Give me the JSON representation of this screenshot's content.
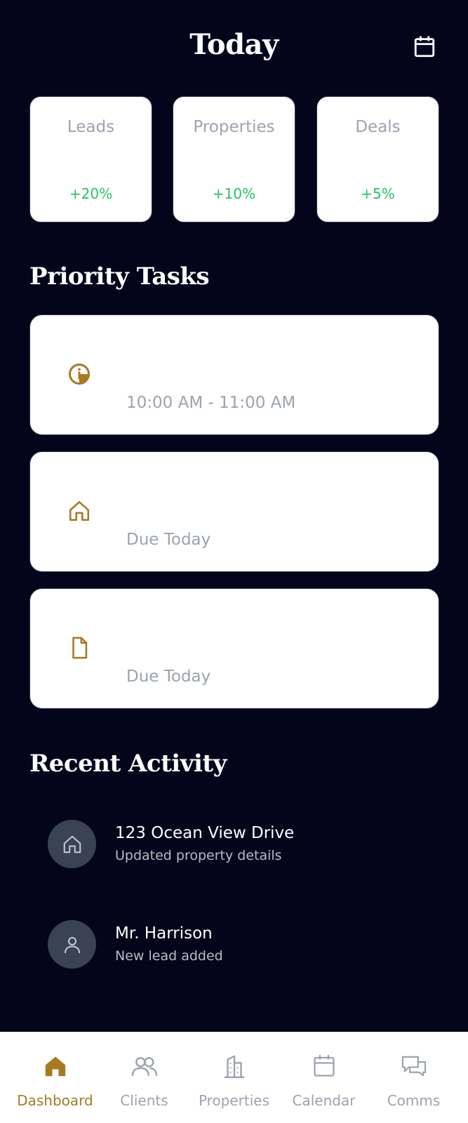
{
  "header": {
    "title": "Today",
    "calendar_icon": "calendar-icon"
  },
  "stats": [
    {
      "label": "Leads",
      "change": "+20%"
    },
    {
      "label": "Properties",
      "change": "+10%"
    },
    {
      "label": "Deals",
      "change": "+5%"
    }
  ],
  "priority_tasks": {
    "title": "Priority Tasks",
    "items": [
      {
        "icon": "info-clock-icon",
        "subtitle": "10:00 AM - 11:00 AM"
      },
      {
        "icon": "home-icon",
        "subtitle": "Due Today"
      },
      {
        "icon": "document-icon",
        "subtitle": "Due Today"
      }
    ]
  },
  "recent_activity": {
    "title": "Recent Activity",
    "items": [
      {
        "icon": "home-icon",
        "title": "123 Ocean View Drive",
        "description": "Updated property details"
      },
      {
        "icon": "user-icon",
        "title": "Mr. Harrison",
        "description": "New lead added"
      }
    ]
  },
  "nav": {
    "active": "Dashboard",
    "items": [
      {
        "label": "Dashboard",
        "icon": "home-icon"
      },
      {
        "label": "Clients",
        "icon": "users-icon"
      },
      {
        "label": "Properties",
        "icon": "building-icon"
      },
      {
        "label": "Calendar",
        "icon": "calendar-icon"
      },
      {
        "label": "Comms",
        "icon": "chat-icon"
      }
    ]
  },
  "colors": {
    "background": "#03061a",
    "accent": "#a77a22",
    "positive": "#22c55e",
    "muted": "#9ca3af"
  }
}
